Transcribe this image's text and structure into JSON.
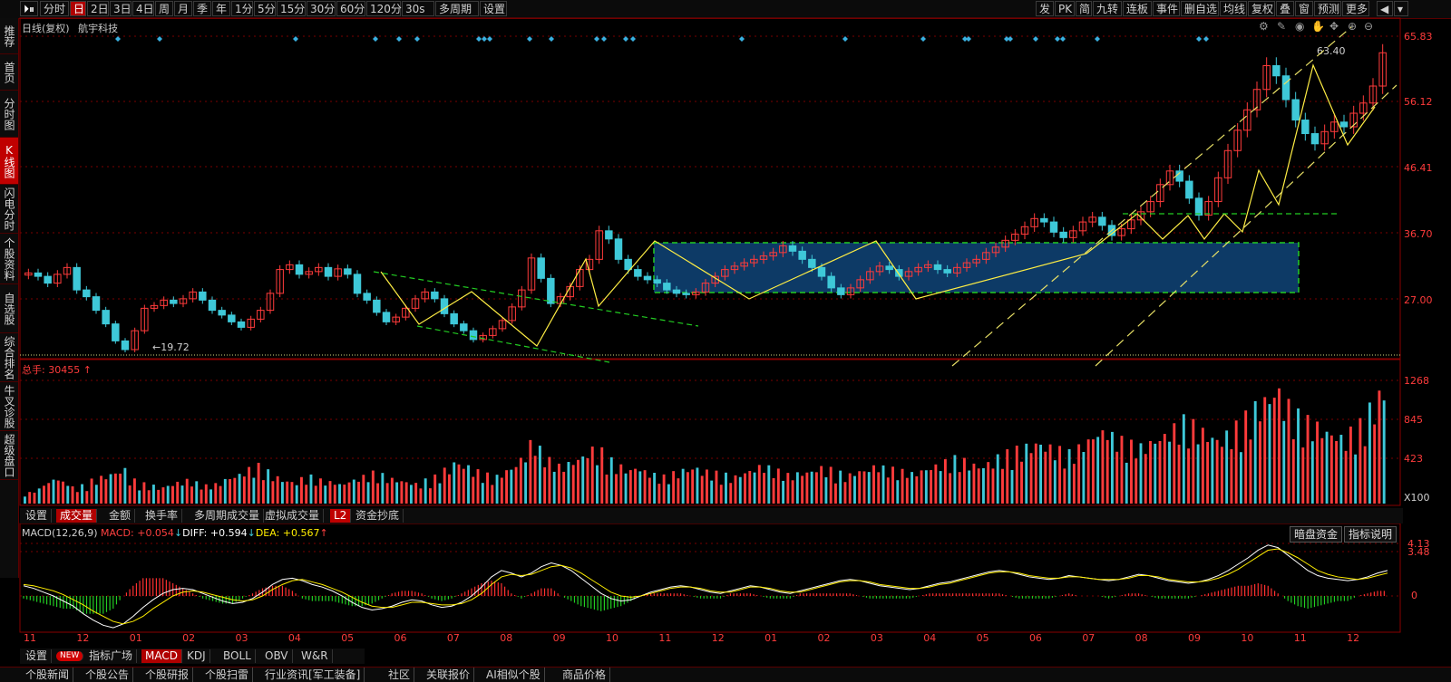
{
  "toolbar": {
    "left": [
      "分时",
      "日",
      "2日",
      "3日",
      "4日",
      "周",
      "月",
      "季",
      "年",
      "1分",
      "5分",
      "15分",
      "30分",
      "60分",
      "120分",
      "30s",
      "多周期",
      "设置"
    ],
    "active": "日",
    "right": [
      "发",
      "PK",
      "简",
      "九转",
      "连板",
      "事件",
      "删自选",
      "均线",
      "复权",
      "叠",
      "窗",
      "预测",
      "更多"
    ]
  },
  "sidebar": {
    "items": [
      "推荐",
      "首页",
      "分时图",
      "K线图",
      "闪电分时",
      "个股资料",
      "自选股",
      "综合排名",
      "牛叉诊股",
      "超级盘口"
    ],
    "active": "K线图"
  },
  "kline": {
    "title": "日线(复权)",
    "stock": "航宇科技",
    "yticks": [
      "65.83",
      "56.12",
      "46.41",
      "36.70",
      "27.00"
    ],
    "low_label": "←19.72",
    "high_label": "63.40"
  },
  "volume": {
    "label": "总手: 30455",
    "yticks": [
      "1268",
      "845",
      "423"
    ],
    "unit": "X100"
  },
  "vol_tabs": [
    "设置",
    "成交量",
    "金额",
    "换手率",
    "多周期成交量",
    "虚拟成交量",
    "L2",
    "资金抄底"
  ],
  "vol_tab_active": "成交量",
  "macd": {
    "name": "MACD(12,26,9)",
    "macd": "MACD: +0.054",
    "diff": "DIFF: +0.594",
    "dea": "DEA: +0.567",
    "yticks": [
      "4.13",
      "3.48",
      "0"
    ],
    "btn_dark": "暗盘资金",
    "btn_help": "指标说明"
  },
  "xaxis": [
    "11",
    "12",
    "01",
    "02",
    "03",
    "04",
    "05",
    "06",
    "07",
    "08",
    "09",
    "10",
    "11",
    "12",
    "01",
    "02",
    "03",
    "04",
    "05",
    "06",
    "07",
    "08",
    "09",
    "10",
    "11",
    "12"
  ],
  "ind_tabs": [
    "设置",
    "NEW",
    "指标广场",
    "MACD",
    "KDJ",
    "BOLL",
    "OBV",
    "W&R"
  ],
  "ind_tab_active": "MACD",
  "bottom": [
    "个股新闻",
    "个股公告",
    "个股研报",
    "个股扫雷",
    "行业资讯[军工装备]",
    "社区",
    "关联报价",
    "AI相似个股",
    "商品价格"
  ],
  "colors": {
    "up": "#ff3b3b",
    "down": "#3ec8d8",
    "diff": "#ffffff",
    "dea": "#ffee00",
    "grid": "#7a0000"
  },
  "chart_data": {
    "type": "candlestick",
    "price_range": [
      19.72,
      65.83
    ],
    "volume_range": [
      0,
      1268
    ],
    "macd_range": [
      -3.0,
      4.13
    ],
    "marked_low": 19.72,
    "marked_high": 63.4,
    "price_path": [
      31.0,
      30.5,
      29.5,
      30.8,
      31.8,
      28.5,
      27.5,
      25.5,
      23.5,
      21.0,
      19.72,
      22.5,
      25.8,
      26.2,
      27.0,
      26.5,
      27.2,
      28.2,
      27.0,
      25.5,
      24.8,
      23.8,
      23.0,
      24.2,
      25.5,
      28.0,
      31.5,
      32.2,
      30.8,
      31.2,
      31.8,
      30.5,
      31.6,
      30.8,
      28.0,
      27.0,
      25.2,
      23.8,
      24.5,
      25.8,
      27.2,
      28.2,
      27.2,
      25.0,
      23.5,
      22.5,
      21.2,
      21.8,
      22.8,
      24.0,
      26.0,
      28.5,
      33.2,
      30.2,
      26.5,
      27.5,
      29.0,
      31.5,
      33.0,
      37.2,
      36.0,
      33.0,
      31.5,
      30.5,
      30.0,
      29.5,
      28.5,
      28.0,
      27.8,
      28.2,
      29.5,
      30.5,
      31.5,
      32.0,
      32.5,
      33.0,
      33.5,
      34.0,
      35.0,
      34.2,
      33.0,
      31.8,
      30.5,
      28.8,
      27.8,
      28.8,
      30.0,
      31.2,
      32.0,
      31.5,
      30.5,
      31.2,
      31.8,
      32.2,
      31.5,
      31.0,
      31.8,
      32.5,
      33.0,
      34.0,
      34.8,
      35.8,
      36.7,
      37.8,
      39.0,
      38.5,
      37.0,
      36.2,
      37.2,
      38.5,
      39.2,
      38.0,
      36.5,
      37.5,
      38.8,
      40.0,
      41.5,
      44.0,
      46.0,
      44.5,
      42.0,
      39.5,
      41.5,
      45.0,
      49.0,
      52.0,
      55.0,
      58.0,
      61.5,
      60.0,
      56.5,
      53.5,
      51.5,
      50.0,
      51.8,
      53.2,
      52.5,
      54.5,
      56.0,
      58.5,
      63.4
    ],
    "volume_path": [
      120,
      160,
      230,
      280,
      240,
      180,
      200,
      260,
      300,
      340,
      380,
      260,
      220,
      200,
      180,
      210,
      240,
      260,
      230,
      200,
      220,
      280,
      320,
      380,
      420,
      360,
      300,
      260,
      240,
      280,
      300,
      260,
      240,
      220,
      260,
      300,
      340,
      320,
      280,
      260,
      240,
      220,
      260,
      300,
      380,
      460,
      420,
      360,
      320,
      300,
      360,
      420,
      520,
      680,
      600,
      480,
      420,
      460,
      520,
      600,
      580,
      480,
      420,
      380,
      400,
      360,
      320,
      300,
      340,
      380,
      400,
      360,
      340,
      320,
      300,
      340,
      380,
      420,
      400,
      360,
      320,
      340,
      360,
      400,
      380,
      340,
      320,
      360,
      380,
      420,
      400,
      380,
      360,
      340,
      380,
      420,
      460,
      500,
      480,
      440,
      420,
      460,
      520,
      560,
      600,
      640,
      680,
      640,
      600,
      560,
      620,
      700,
      780,
      820,
      760,
      700,
      660,
      640,
      700,
      760,
      840,
      920,
      880,
      820,
      760,
      720,
      780,
      860,
      960,
      1080,
      1180,
      1268,
      1100,
      980,
      920,
      880,
      820,
      780,
      740,
      800,
      880,
      1060,
      1240
    ],
    "diff_path": [
      0.8,
      0.6,
      0.3,
      0.0,
      -0.4,
      -0.8,
      -1.4,
      -1.9,
      -2.3,
      -2.5,
      -2.2,
      -1.6,
      -0.9,
      -0.3,
      0.2,
      0.5,
      0.6,
      0.5,
      0.2,
      -0.1,
      -0.4,
      -0.6,
      -0.5,
      -0.2,
      0.3,
      0.9,
      1.3,
      1.4,
      1.2,
      0.9,
      0.7,
      0.4,
      0.0,
      -0.5,
      -0.9,
      -1.1,
      -1.0,
      -0.8,
      -0.5,
      -0.3,
      -0.4,
      -0.7,
      -0.9,
      -0.8,
      -0.5,
      0.0,
      0.7,
      1.5,
      2.0,
      1.8,
      1.5,
      1.8,
      2.3,
      2.6,
      2.4,
      2.0,
      1.4,
      0.8,
      0.2,
      -0.2,
      -0.4,
      -0.3,
      0.0,
      0.3,
      0.5,
      0.7,
      0.8,
      0.7,
      0.5,
      0.3,
      0.2,
      0.4,
      0.6,
      0.8,
      0.7,
      0.5,
      0.3,
      0.2,
      0.4,
      0.6,
      0.8,
      1.0,
      1.2,
      1.3,
      1.2,
      1.0,
      0.8,
      0.7,
      0.6,
      0.5,
      0.6,
      0.8,
      1.0,
      1.1,
      1.3,
      1.5,
      1.7,
      1.9,
      2.0,
      1.9,
      1.7,
      1.5,
      1.4,
      1.3,
      1.4,
      1.6,
      1.5,
      1.4,
      1.3,
      1.2,
      1.3,
      1.5,
      1.7,
      1.6,
      1.4,
      1.2,
      1.1,
      1.0,
      1.1,
      1.3,
      1.6,
      2.0,
      2.5,
      3.0,
      3.6,
      4.0,
      3.8,
      3.2,
      2.6,
      2.0,
      1.6,
      1.4,
      1.3,
      1.2,
      1.3,
      1.5,
      1.8,
      2.0
    ],
    "dea_path": [
      0.9,
      0.8,
      0.6,
      0.4,
      0.1,
      -0.3,
      -0.7,
      -1.2,
      -1.6,
      -2.0,
      -2.2,
      -2.0,
      -1.6,
      -1.0,
      -0.5,
      0.0,
      0.3,
      0.4,
      0.3,
      0.1,
      -0.1,
      -0.3,
      -0.4,
      -0.3,
      0.0,
      0.5,
      0.9,
      1.2,
      1.3,
      1.1,
      0.9,
      0.6,
      0.3,
      -0.1,
      -0.5,
      -0.8,
      -0.9,
      -0.9,
      -0.7,
      -0.5,
      -0.5,
      -0.6,
      -0.7,
      -0.7,
      -0.6,
      -0.3,
      0.2,
      0.9,
      1.5,
      1.7,
      1.6,
      1.7,
      2.0,
      2.3,
      2.4,
      2.2,
      1.8,
      1.3,
      0.8,
      0.3,
      0.0,
      -0.1,
      0.0,
      0.2,
      0.4,
      0.6,
      0.7,
      0.7,
      0.6,
      0.4,
      0.3,
      0.3,
      0.5,
      0.7,
      0.7,
      0.6,
      0.4,
      0.3,
      0.3,
      0.5,
      0.7,
      0.9,
      1.1,
      1.2,
      1.2,
      1.1,
      0.9,
      0.8,
      0.7,
      0.6,
      0.6,
      0.7,
      0.9,
      1.0,
      1.2,
      1.4,
      1.6,
      1.8,
      1.9,
      1.9,
      1.8,
      1.6,
      1.5,
      1.4,
      1.4,
      1.5,
      1.5,
      1.4,
      1.3,
      1.3,
      1.3,
      1.4,
      1.6,
      1.6,
      1.5,
      1.3,
      1.2,
      1.1,
      1.1,
      1.2,
      1.4,
      1.7,
      2.1,
      2.6,
      3.1,
      3.6,
      3.7,
      3.4,
      3.0,
      2.5,
      2.0,
      1.7,
      1.5,
      1.4,
      1.3,
      1.4,
      1.6,
      1.8
    ]
  }
}
